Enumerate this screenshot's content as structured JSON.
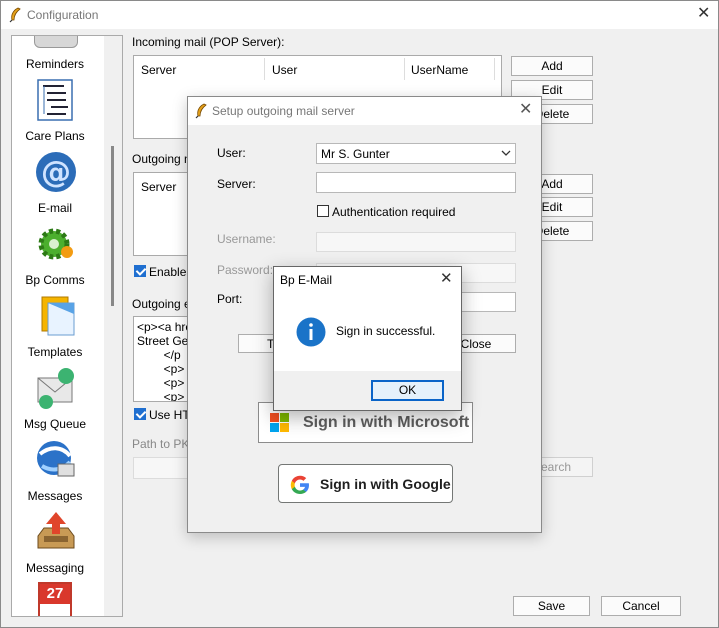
{
  "main_window": {
    "title": "Configuration",
    "sidebar": [
      {
        "label": "Reminders",
        "icon": "bell-reminders-icon"
      },
      {
        "label": "Care Plans",
        "icon": "care-plans-tree-icon"
      },
      {
        "label": "E-mail",
        "icon": "at-sign-icon"
      },
      {
        "label": "Bp Comms",
        "icon": "green-gear-icon"
      },
      {
        "label": "Templates",
        "icon": "templates-icon"
      },
      {
        "label": "Msg Queue",
        "icon": "envelope-queue-icon"
      },
      {
        "label": "Messages",
        "icon": "messages-globe-icon"
      },
      {
        "label": "Messaging",
        "icon": "inbox-tray-icon"
      },
      {
        "label": "",
        "icon": "calendar-27-icon",
        "calendar_day": "27"
      }
    ],
    "incoming": {
      "label": "Incoming mail (POP Server):",
      "columns": [
        "Server",
        "User",
        "UserName"
      ],
      "buttons": {
        "add": "Add",
        "edit": "Edit",
        "delete": "Delete"
      }
    },
    "outgoing": {
      "label_partial": "Outgoing ma",
      "columns": [
        "Server"
      ],
      "buttons": {
        "add": "Add",
        "edit": "Edit",
        "delete": "Delete"
      }
    },
    "enable_checkbox_label": "Enable T",
    "outgoing_email_label": "Outgoing em",
    "html_lines": [
      "<p><a href",
      "Street Gene",
      "        </p",
      "        <p>",
      "        <p>",
      "        <p>"
    ],
    "use_html_label": "Use HTI",
    "path_label": "Path to PKI",
    "search_button": "Search",
    "save_button": "Save",
    "cancel_button": "Cancel"
  },
  "setup_dialog": {
    "title": "Setup outgoing mail server",
    "user_label": "User:",
    "user_value": "Mr S. Gunter",
    "server_label": "Server:",
    "server_value": "",
    "auth_label": "Authentication required",
    "username_label": "Username:",
    "password_label": "Password:",
    "port_label": "Port:",
    "test_button": "Test",
    "close_button": "Close",
    "microsoft_button": "Sign in with Microsoft",
    "google_button": "Sign in with Google"
  },
  "message_box": {
    "title": "Bp E-Mail",
    "message": "Sign in successful.",
    "ok_button": "OK"
  },
  "colors": {
    "accent": "#1f6fd0",
    "info_icon": "#1a73c8",
    "window_bg": "#f0f0f0",
    "focus_border": "#0a64c8"
  }
}
